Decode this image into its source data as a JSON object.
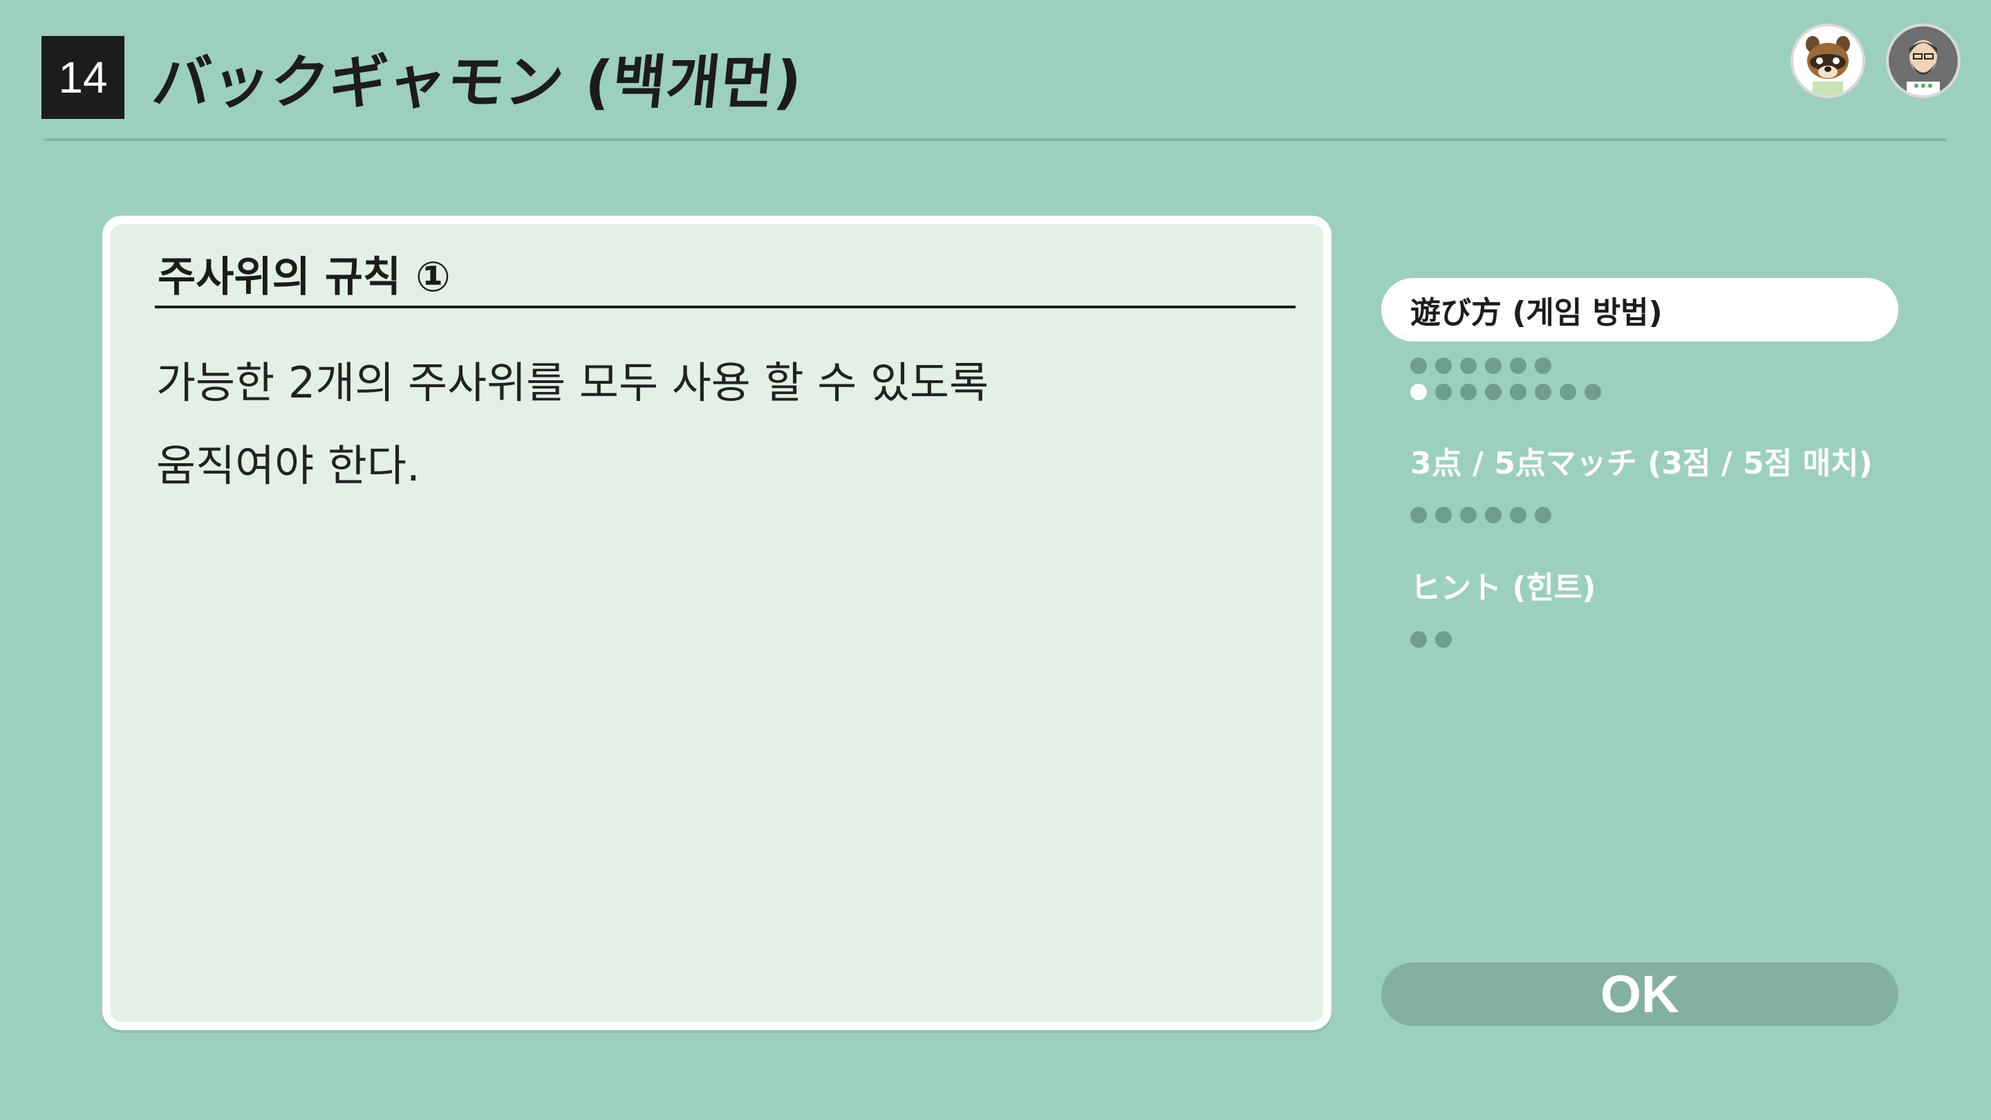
{
  "header": {
    "number": "14",
    "title": "バックギャモン (백개먼)"
  },
  "avatars": [
    {
      "icon": "tanuki-character-avatar-icon"
    },
    {
      "icon": "bearded-man-avatar-icon"
    }
  ],
  "card": {
    "title": "주사위의 규칙 ①",
    "body": "가능한 2개의 주사위를 모두 사용 할 수 있도록\n움직여야 한다."
  },
  "menu": [
    {
      "label": "遊び方 (게임 방법)",
      "active": true,
      "dot_rows": [
        6,
        8
      ],
      "current_page": 7
    },
    {
      "label": "3点 / 5点マッチ (3점 / 5점 매치)",
      "active": false,
      "dot_rows": [
        6
      ],
      "current_page": null
    },
    {
      "label": "ヒント (힌트)",
      "active": false,
      "dot_rows": [
        2
      ],
      "current_page": null
    }
  ],
  "ok_label": "OK",
  "colors": {
    "background": "#9dcfbd",
    "card": "#e2f0e6",
    "dot": "#6f9d8e",
    "ok_button": "#84b09f"
  }
}
